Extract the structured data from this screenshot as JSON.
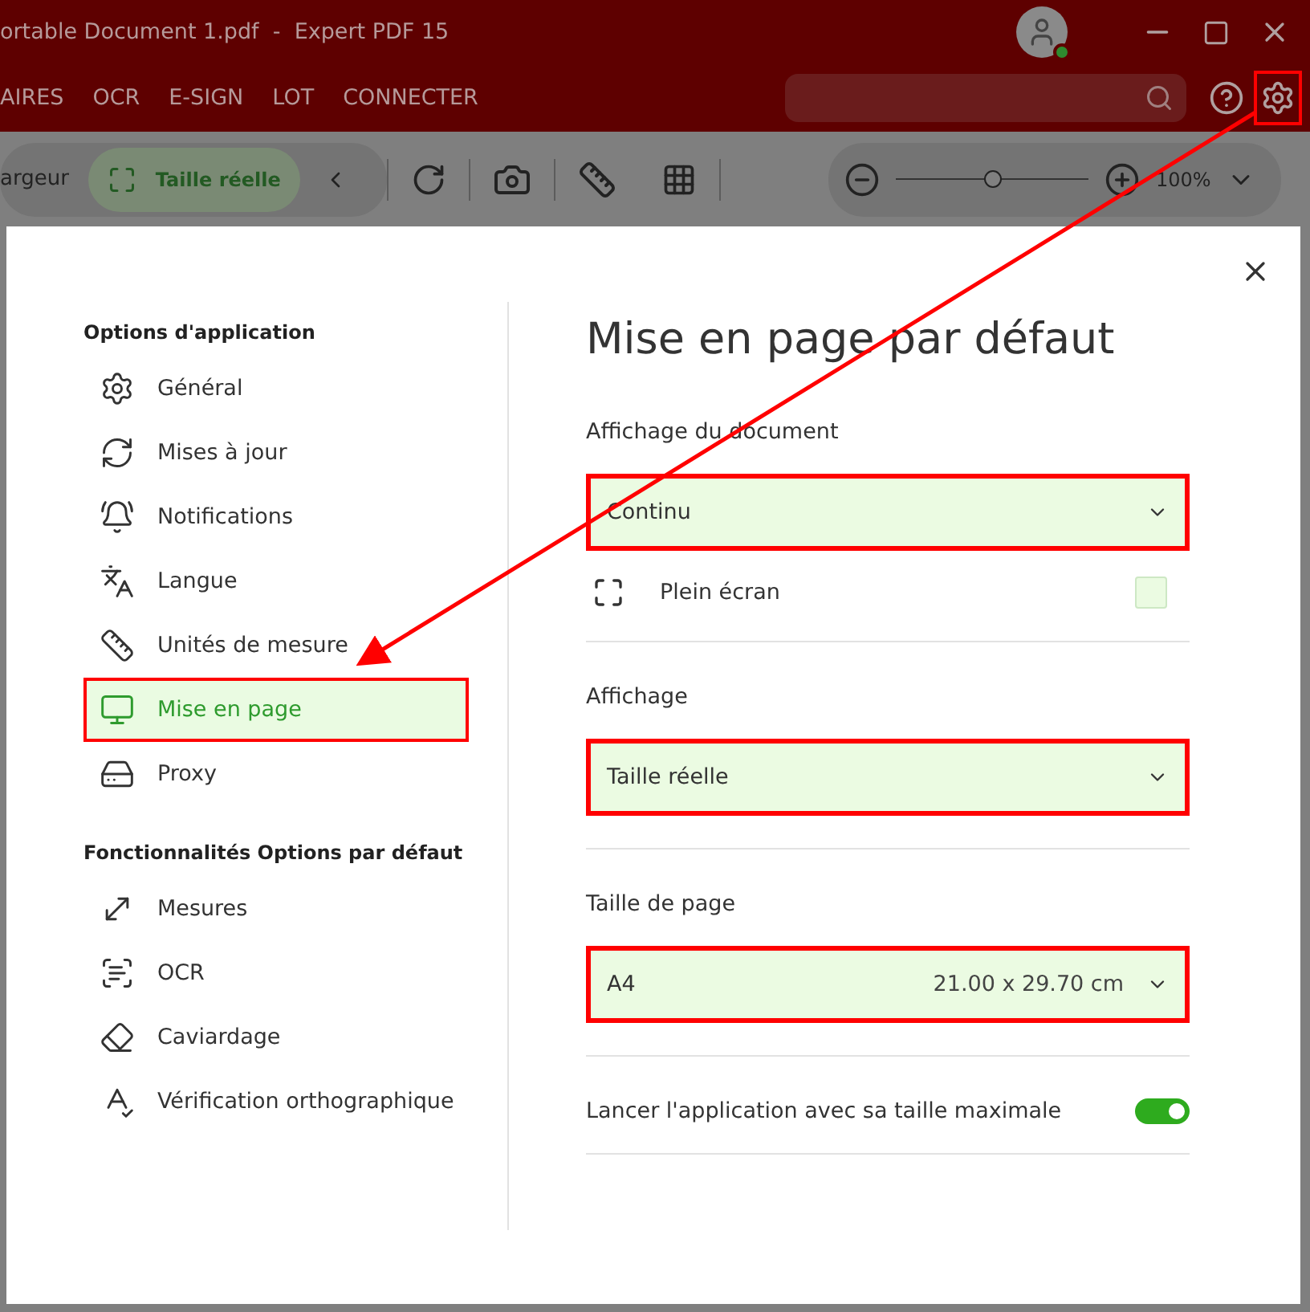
{
  "window": {
    "title": "ortable Document 1.pdf  -  Expert PDF 15"
  },
  "menu": [
    "AIRES",
    "OCR",
    "E-SIGN",
    "LOT",
    "CONNECTER"
  ],
  "toolbar": {
    "cut_label": "argeur",
    "view_button": {
      "label": "Taille réelle",
      "selected": true
    },
    "zoom": {
      "level": 0.5,
      "reading": "100%"
    }
  },
  "dialog": {
    "sections": [
      {
        "title": "Options d'application",
        "items": [
          {
            "label": "Général",
            "selected": false
          },
          {
            "label": "Mises à jour",
            "selected": false
          },
          {
            "label": "Notifications",
            "selected": false
          },
          {
            "label": "Langue",
            "selected": false
          },
          {
            "label": "Unités de mesure",
            "selected": false
          },
          {
            "label": "Mise en page",
            "selected": true
          },
          {
            "label": "Proxy",
            "selected": false
          }
        ]
      },
      {
        "title": "Fonctionnalités Options par défaut",
        "items": [
          {
            "label": "Mesures",
            "selected": false
          },
          {
            "label": "OCR",
            "selected": false
          },
          {
            "label": "Caviardage",
            "selected": false
          },
          {
            "label": "Vérification orthographique",
            "selected": false
          }
        ]
      }
    ],
    "heading": "Mise en page par défaut",
    "groups": [
      {
        "label": "Affichage du document",
        "select": {
          "value": "Continu"
        },
        "option": {
          "label": "Plein écran",
          "checked": false
        }
      },
      {
        "label": "Affichage",
        "select": {
          "value": "Taille réelle"
        }
      },
      {
        "label": "Taille de page",
        "select": {
          "value": "A4",
          "detail": "21.00 x 29.70 cm"
        }
      }
    ],
    "toggle": {
      "label": "Lancer l'application avec sa taille maximale",
      "on": true
    }
  }
}
